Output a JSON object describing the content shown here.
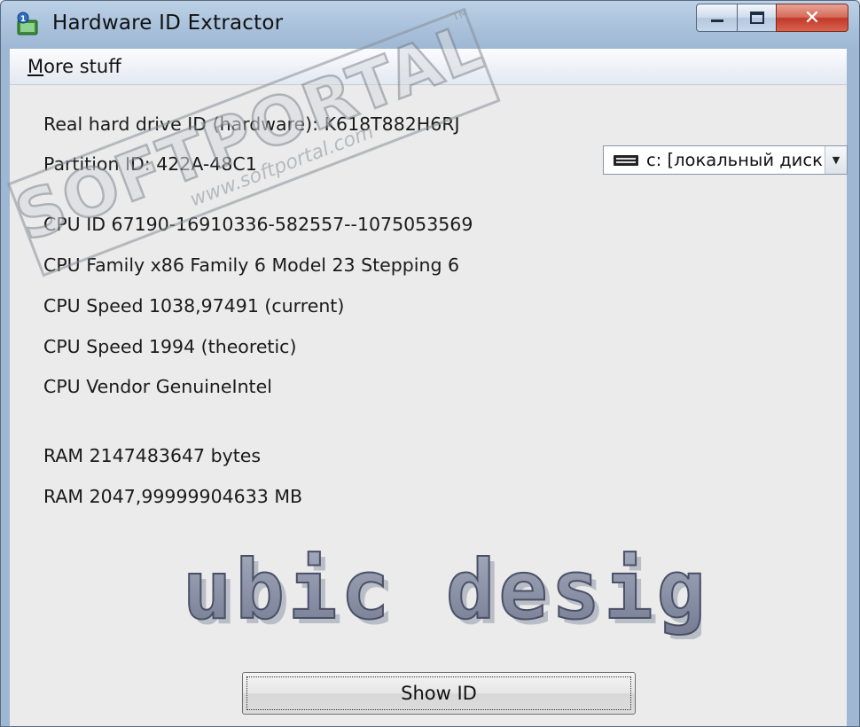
{
  "window": {
    "title": "Hardware ID Extractor",
    "caption": {
      "close_symbol": "✕"
    }
  },
  "menu": {
    "item_prefix": "M",
    "item_rest": "ore stuff"
  },
  "info": {
    "hdd_id": "Real hard drive ID (hardware): K618T882H6RJ",
    "partition_id": "Partition ID: 422A-48C1",
    "cpu_id": "CPU ID 67190-16910336-582557--1075053569",
    "cpu_family": "CPU Family x86 Family 6 Model 23 Stepping 6",
    "cpu_speed_current": "CPU Speed 1038,97491 (current)",
    "cpu_speed_theoretic": "CPU Speed 1994 (theoretic)",
    "cpu_vendor": "CPU Vendor GenuineIntel",
    "ram_bytes": "RAM 2147483647 bytes",
    "ram_mb": "RAM 2047,99999904633 MB"
  },
  "drive_select": {
    "selected": "c: [локальный диск"
  },
  "logo_text": "cubic design",
  "watermark": {
    "brand": "SOFTPORTAL",
    "tm": "TM",
    "url": "www.softportal.com"
  },
  "buttons": {
    "show_id": "Show ID"
  },
  "colors": {
    "title_bar": "#a9c1db",
    "client_bg": "#ebebeb",
    "close_button": "#c0392b",
    "logo_fill": "#8c93a8"
  }
}
